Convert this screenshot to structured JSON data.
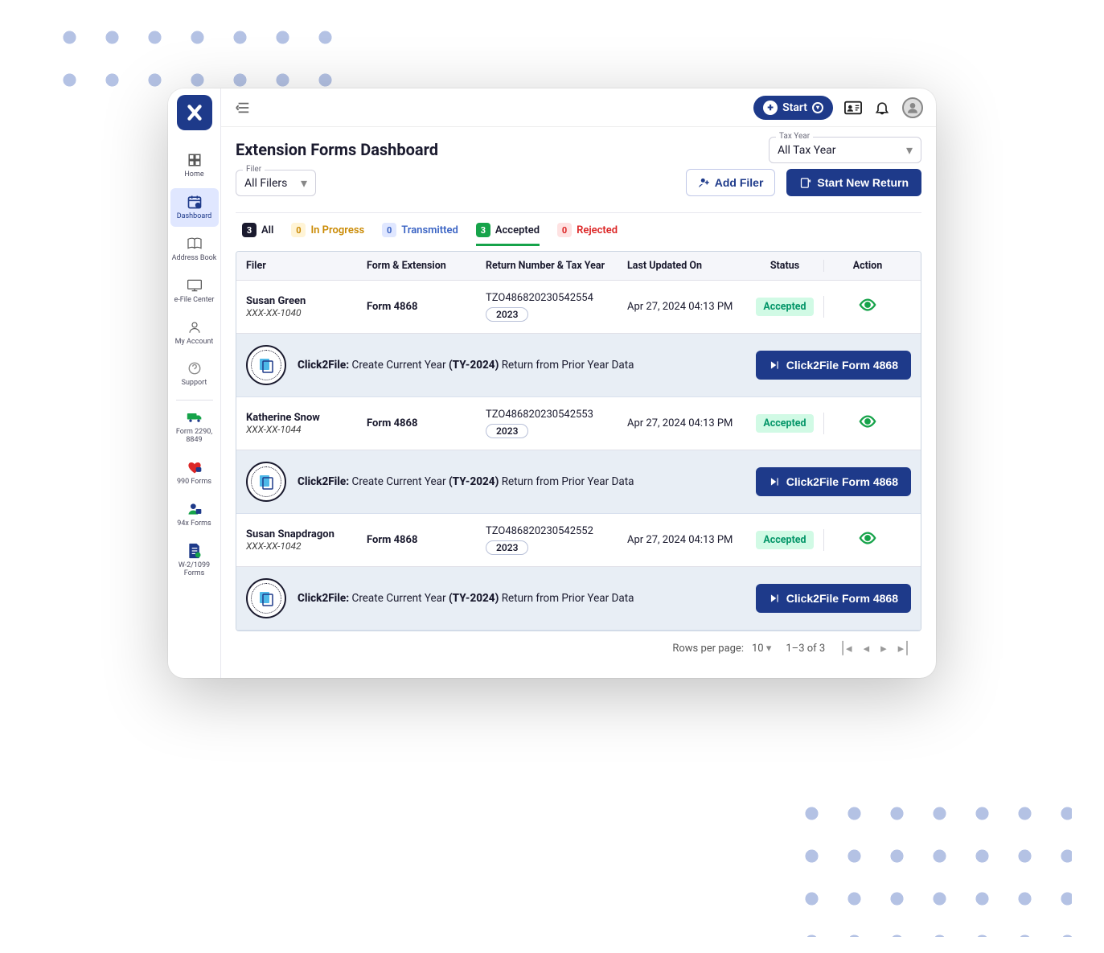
{
  "header": {
    "start_label": "Start"
  },
  "sidebar": {
    "home": "Home",
    "dashboard": "Dashboard",
    "address_book": "Address Book",
    "efile": "e-File Center",
    "my_account": "My Account",
    "support": "Support",
    "form2290": "Form 2290, 8849",
    "form990": "990 Forms",
    "form94x": "94x Forms",
    "w2_1099": "W-2/1099 Forms"
  },
  "page": {
    "title": "Extension Forms Dashboard",
    "tax_year_label": "Tax Year",
    "tax_year_value": "All Tax Year",
    "filer_label": "Filer",
    "filer_value": "All Filers",
    "add_filer": "Add Filer",
    "start_return": "Start New Return"
  },
  "tabs": {
    "all_count": "3",
    "all_label": "All",
    "inprogress_count": "0",
    "inprogress_label": "In Progress",
    "transmitted_count": "0",
    "transmitted_label": "Transmitted",
    "accepted_count": "3",
    "accepted_label": "Accepted",
    "rejected_count": "0",
    "rejected_label": "Rejected"
  },
  "thead": {
    "filer": "Filer",
    "form": "Form & Extension",
    "return": "Return Number & Tax Year",
    "updated": "Last Updated On",
    "status": "Status",
    "action": "Action"
  },
  "rows": [
    {
      "name": "Susan Green",
      "ssn": "XXX-XX-1040",
      "form": "Form 4868",
      "return_num": "TZO486820230542554",
      "year": "2023",
      "updated": "Apr 27, 2024 04:13 PM",
      "status": "Accepted"
    },
    {
      "name": "Katherine Snow",
      "ssn": "XXX-XX-1044",
      "form": "Form 4868",
      "return_num": "TZO486820230542553",
      "year": "2023",
      "updated": "Apr 27, 2024 04:13 PM",
      "status": "Accepted"
    },
    {
      "name": "Susan Snapdragon",
      "ssn": "XXX-XX-1042",
      "form": "Form 4868",
      "return_num": "TZO486820230542552",
      "year": "2023",
      "updated": "Apr 27, 2024 04:13 PM",
      "status": "Accepted"
    }
  ],
  "c2f": {
    "prefix": "Click2File:",
    "text1": " Create Current Year ",
    "ty": "(TY-2024)",
    "text2": " Return from Prior Year Data",
    "button": "Click2File Form 4868"
  },
  "pager": {
    "rpp_label": "Rows per page:",
    "rpp_value": "10",
    "range": "1–3 of 3"
  }
}
